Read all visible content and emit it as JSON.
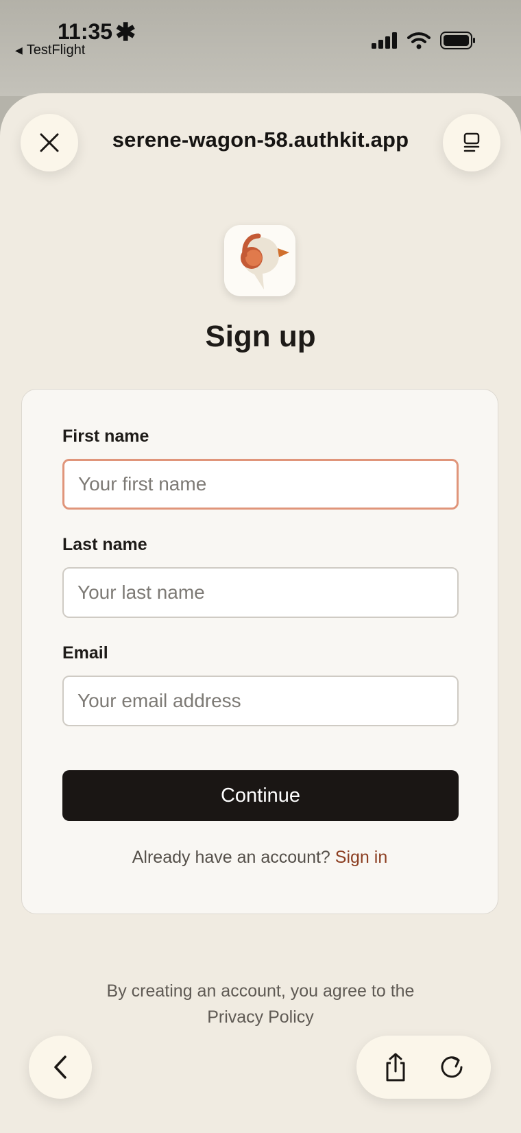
{
  "status_bar": {
    "time": "11:35",
    "indicator": "✱",
    "back_app": "TestFlight",
    "back_glyph": "◀",
    "icons": [
      "signal-icon",
      "wifi-icon",
      "battery-icon"
    ]
  },
  "browser": {
    "url": "serene-wagon-58.authkit.app",
    "close_icon": "close-icon",
    "reader_icon": "reader-icon"
  },
  "page": {
    "title": "Sign up",
    "logo": "app-logo-icon"
  },
  "form": {
    "first_name": {
      "label": "First name",
      "placeholder": "Your first name",
      "value": ""
    },
    "last_name": {
      "label": "Last name",
      "placeholder": "Your last name",
      "value": ""
    },
    "email": {
      "label": "Email",
      "placeholder": "Your email address",
      "value": ""
    },
    "submit_label": "Continue",
    "signin_prompt": "Already have an account?",
    "signin_link": "Sign in"
  },
  "legal": {
    "line1": "By creating an account, you agree to the",
    "line2": "Privacy Policy"
  },
  "toolbar": {
    "back_icon": "chevron-left-icon",
    "share_icon": "share-icon",
    "reload_icon": "reload-icon"
  },
  "colors": {
    "sheet_background": "#f0ebe1",
    "card_background": "#f9f7f3",
    "focus_border": "#e0957a",
    "primary_button": "#1a1614",
    "link": "#8c3f22"
  }
}
